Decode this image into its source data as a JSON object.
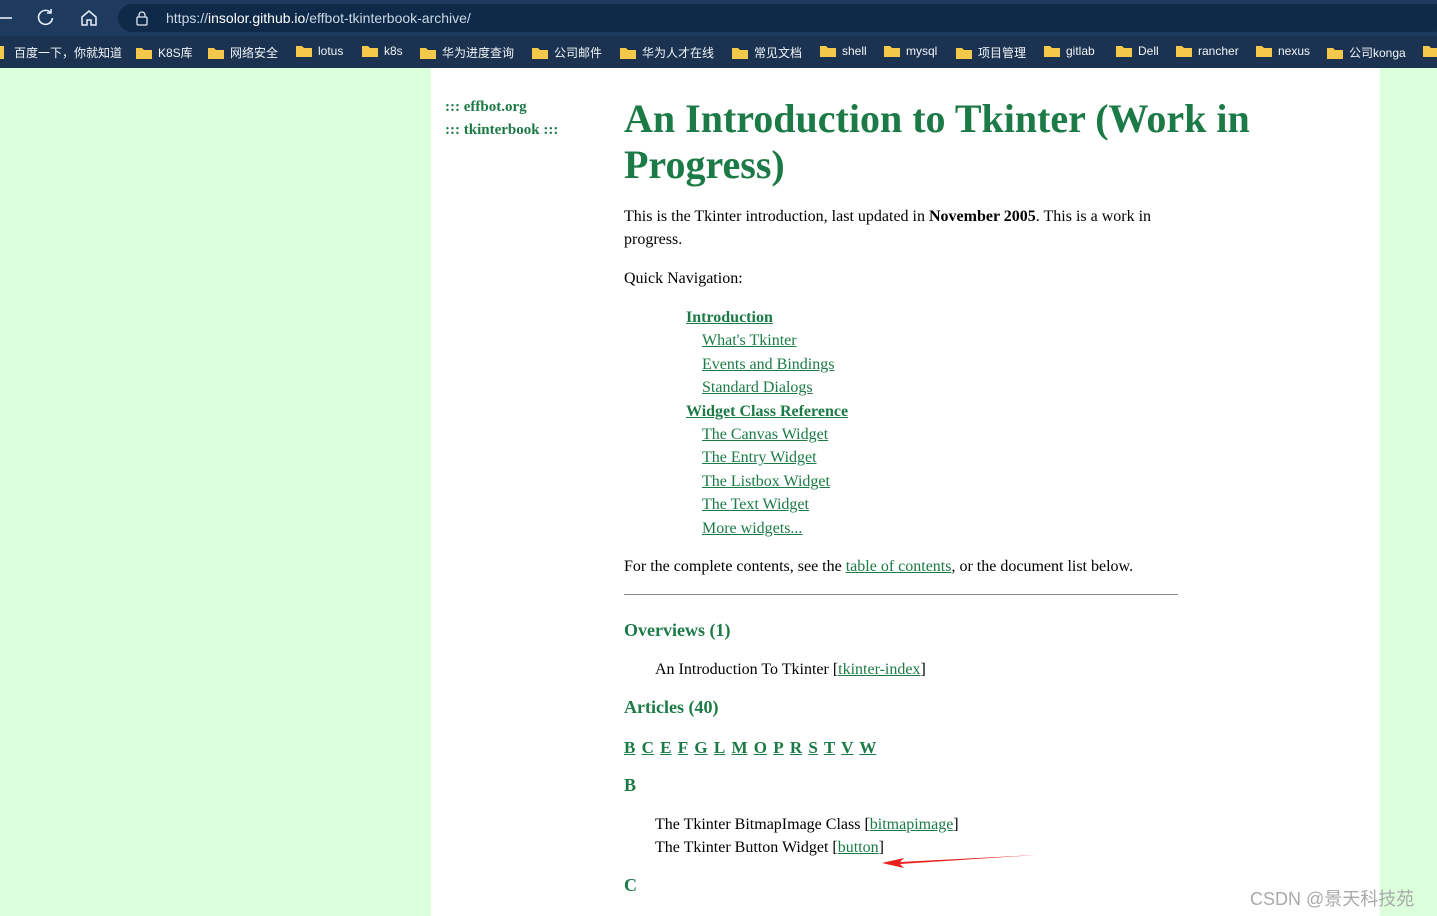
{
  "browser": {
    "url_scheme": "https://",
    "url_host": "insolor.github.io",
    "url_path": "/effbot-tkinterbook-archive/"
  },
  "bookmarks": [
    "百度一下，你就知道",
    "K8S库",
    "网络安全",
    "lotus",
    "k8s",
    "华为进度查询",
    "公司邮件",
    "华为人才在线",
    "常见文档",
    "shell",
    "mysql",
    "项目管理",
    "gitlab",
    "Dell",
    "rancher",
    "nexus",
    "公司konga"
  ],
  "sidebar": {
    "links": [
      "::: effbot.org",
      "::: tkinterbook :::"
    ]
  },
  "content": {
    "title": "An Introduction to Tkinter (Work in Progress)",
    "intro_before": "This is the Tkinter introduction, last updated in ",
    "intro_bold": "November 2005",
    "intro_after": ". This is a work in progress.",
    "quick_nav_label": "Quick Navigation:",
    "quick_nav": [
      {
        "label": "Introduction",
        "level": 1
      },
      {
        "label": "What's Tkinter",
        "level": 2
      },
      {
        "label": "Events and Bindings",
        "level": 2
      },
      {
        "label": "Standard Dialogs",
        "level": 2
      },
      {
        "label": "Widget Class Reference",
        "level": 1
      },
      {
        "label": "The Canvas Widget",
        "level": 2
      },
      {
        "label": "The Entry Widget",
        "level": 2
      },
      {
        "label": "The Listbox Widget",
        "level": 2
      },
      {
        "label": "The Text Widget",
        "level": 2
      },
      {
        "label": "More widgets...",
        "level": 2
      }
    ],
    "contents_before": "For the complete contents, see the ",
    "contents_link": "table of contents",
    "contents_after": ", or the document list below.",
    "overviews_heading": "Overviews (1)",
    "overview_entry_text": "An Introduction To Tkinter [",
    "overview_entry_link": "tkinter-index",
    "bracket_close": "]",
    "articles_heading": "Articles (40)",
    "letters": [
      "B",
      "C",
      "E",
      "F",
      "G",
      "L",
      "M",
      "O",
      "P",
      "R",
      "S",
      "T",
      "V",
      "W"
    ],
    "section_b": "B",
    "b_entries": [
      {
        "text": "The Tkinter BitmapImage Class [",
        "link": "bitmapimage"
      },
      {
        "text": "The Tkinter Button Widget [",
        "link": "button"
      }
    ],
    "section_c": "C"
  },
  "annotation": {
    "arrow_color": "#e8201c"
  },
  "watermark": "CSDN @景天科技苑"
}
